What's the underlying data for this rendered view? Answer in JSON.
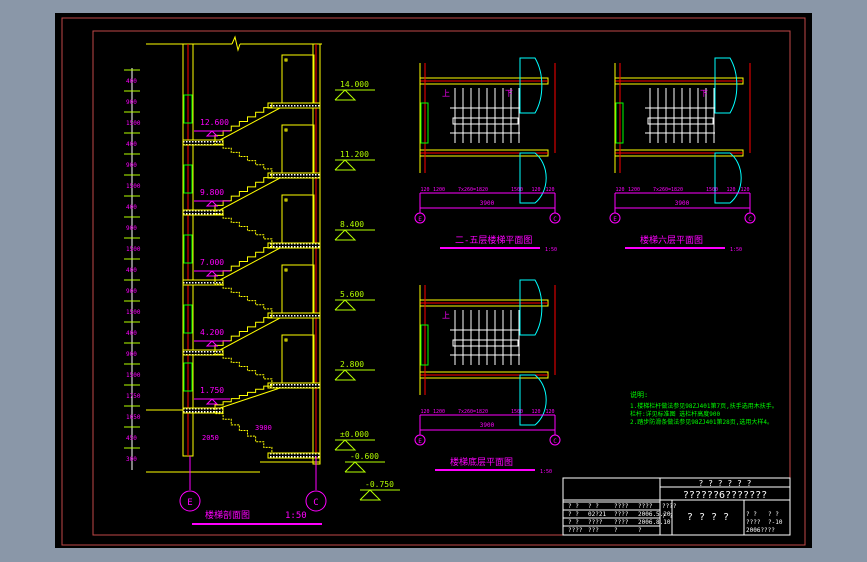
{
  "colors": {
    "background": "#8a97a8",
    "canvas": "#000000",
    "frame": "#c04848",
    "wall": "#ffff00",
    "axis": "#ff00ff",
    "level": "#b4ff00",
    "window": "#00ff00",
    "door": "#00ffff",
    "red": "#ff0000",
    "white": "#ffffff"
  },
  "section": {
    "title": "楼梯剖面图",
    "scale": "1:50",
    "axes": [
      "E",
      "C"
    ],
    "landing_levels": [
      "12.600",
      "9.800",
      "7.000",
      "4.200",
      "1.750"
    ],
    "floor_levels": [
      "14.000",
      "11.200",
      "8.400",
      "5.600",
      "2.800",
      "±0.000",
      "-0.600",
      "-0.750"
    ],
    "dims_left": [
      "400",
      "900",
      "1500",
      "400",
      "900",
      "1500",
      "400",
      "900",
      "1500",
      "400",
      "900",
      "1500",
      "400",
      "900",
      "1500",
      "1750",
      "1050",
      "450",
      "300"
    ],
    "dims_stair": [
      "2050",
      "3900"
    ]
  },
  "plans": [
    {
      "title": "二-五层楼梯平面图",
      "scale": "1:50",
      "up": "上",
      "down": "下",
      "axes": [
        "E",
        "C"
      ],
      "dims": [
        "120",
        "1200",
        "7x260=1820",
        "1500",
        "120",
        "120"
      ],
      "total": "3900"
    },
    {
      "title": "楼梯六层平面图",
      "scale": "1:50",
      "down": "下",
      "axes": [
        "E",
        "C"
      ],
      "dims": [
        "120",
        "1200",
        "7x260=1820",
        "1500",
        "120",
        "120"
      ],
      "total": "3900"
    },
    {
      "title": "楼梯底层平面图",
      "scale": "1:50",
      "up": "上",
      "axes": [
        "E",
        "C"
      ],
      "dims": [
        "120",
        "1200",
        "7x260=1820",
        "1500",
        "120",
        "120"
      ],
      "total": "3900"
    }
  ],
  "notes": {
    "heading": "说明:",
    "lines": [
      "1.楼梯栏杆做法参见98ZJ401第7页,扶手选用木扶手。",
      "栏杆:详见标准图 选栏杆高度900",
      "2.踏步防滑条做法参见98ZJ401第28页,选用大样4。"
    ]
  },
  "title_block": {
    "header_top": "? ? ? ? ? ?",
    "header_project": "??????6???????",
    "drawing_name": "? ? ? ?",
    "cells": [
      "? ?",
      "? ?",
      "????",
      "????",
      "?  ?",
      "02?21",
      "????",
      "2006.5.20",
      "?  ?",
      "????",
      "????",
      "2006.8.10",
      "????",
      "???",
      "?",
      "?",
      "????",
      "?  ?",
      "?  ?",
      "?  ?",
      "????",
      "?-10",
      "2006????"
    ]
  }
}
